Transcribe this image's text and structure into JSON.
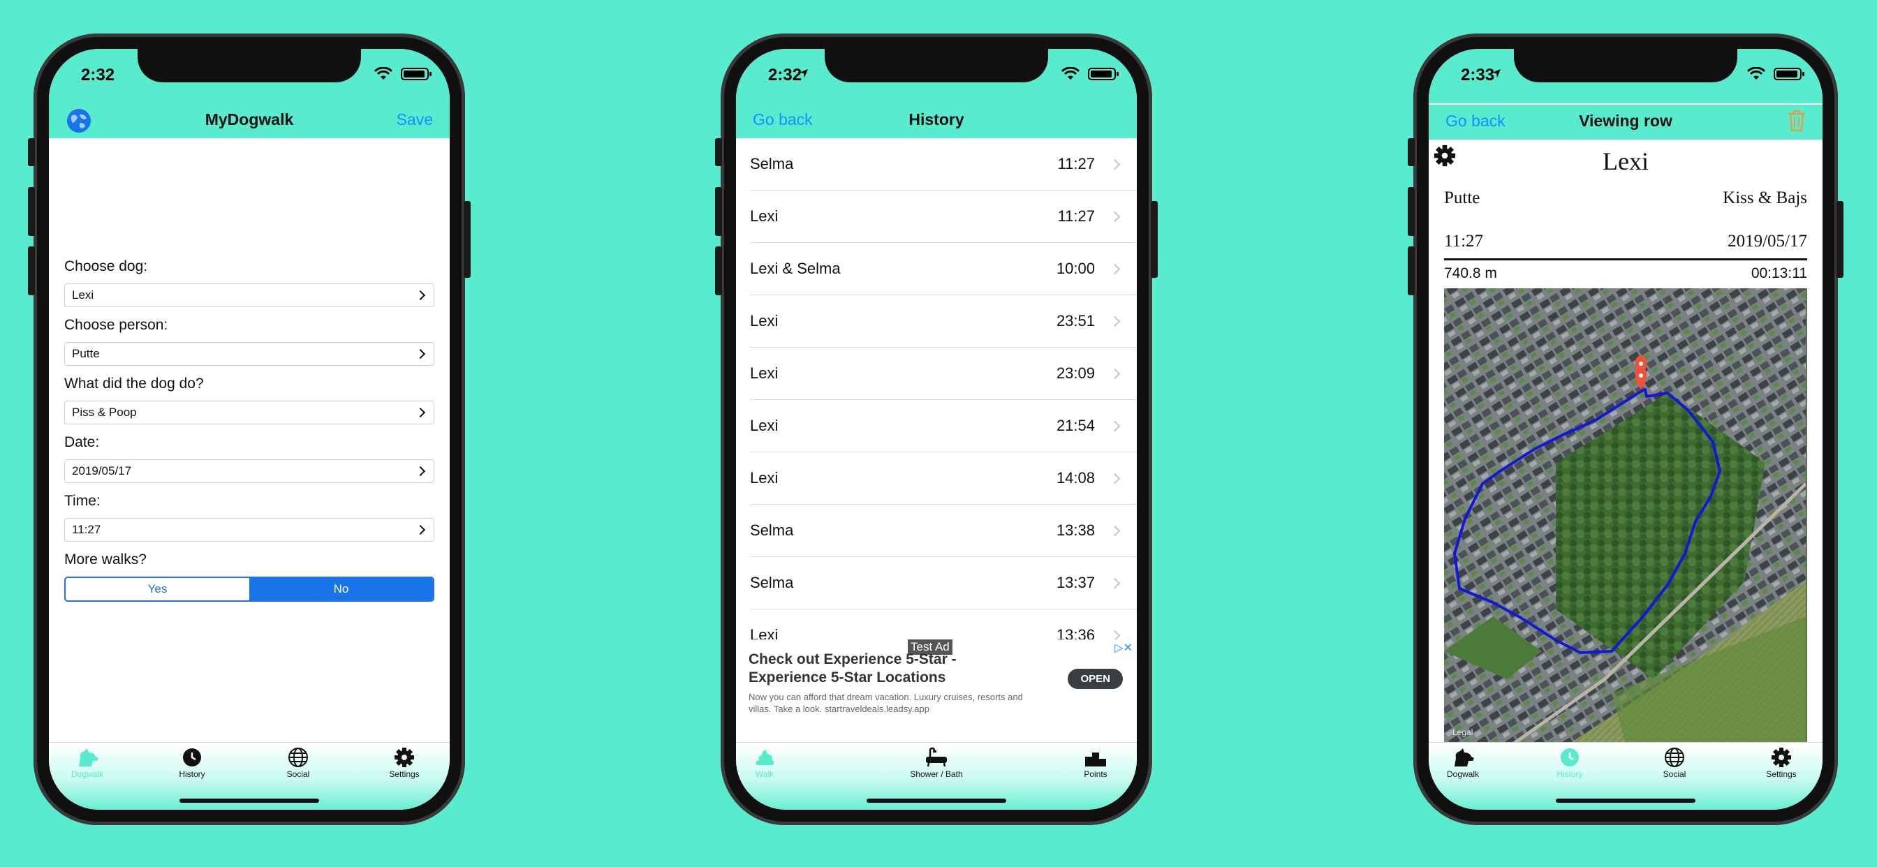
{
  "phone1": {
    "status_time": "2:32",
    "nav": {
      "title": "MyDogwalk",
      "right": "Save"
    },
    "form": {
      "dog_label": "Choose dog:",
      "dog_value": "Lexi",
      "person_label": "Choose person:",
      "person_value": "Putte",
      "action_label": "What did the dog do?",
      "action_value": "Piss & Poop",
      "date_label": "Date:",
      "date_value": "2019/05/17",
      "time_label": "Time:",
      "time_value": "11:27",
      "more_label": "More walks?",
      "yes": "Yes",
      "no": "No",
      "selected": "No"
    },
    "tabs": [
      "Dogwalk",
      "History",
      "Social",
      "Settings"
    ],
    "active_tab": "Dogwalk"
  },
  "phone2": {
    "status_time": "2:32",
    "nav": {
      "left": "Go back",
      "title": "History"
    },
    "rows": [
      {
        "name": "Selma",
        "time": "11:27"
      },
      {
        "name": "Lexi",
        "time": "11:27"
      },
      {
        "name": "Lexi & Selma",
        "time": "10:00"
      },
      {
        "name": "Lexi",
        "time": "23:51"
      },
      {
        "name": "Lexi",
        "time": "23:09"
      },
      {
        "name": "Lexi",
        "time": "21:54"
      },
      {
        "name": "Lexi",
        "time": "14:08"
      },
      {
        "name": "Selma",
        "time": "13:38"
      },
      {
        "name": "Selma",
        "time": "13:37"
      },
      {
        "name": "Lexi",
        "time": "13:36"
      }
    ],
    "ad": {
      "tag": "Test Ad",
      "headline": "Check out Experience 5-Star - Experience 5-Star Locations",
      "body": "Now you can afford that dream vacation. Luxury cruises, resorts and villas. Take a look. startraveldeals.leadsy.app",
      "button": "OPEN"
    },
    "tabs": [
      "Walk",
      "Shower / Bath",
      "Points"
    ],
    "active_tab": "Walk"
  },
  "phone3": {
    "status_time": "2:33",
    "nav": {
      "left": "Go back",
      "title": "Viewing row"
    },
    "dog": "Lexi",
    "person": "Putte",
    "action": "Kiss & Bajs",
    "time": "11:27",
    "date": "2019/05/17",
    "distance": "740.8 m",
    "duration": "00:13:11",
    "map_credit": "Legal",
    "tabs": [
      "Dogwalk",
      "History",
      "Social",
      "Settings"
    ],
    "active_tab": "History"
  },
  "colors": {
    "background": "#58ebce",
    "link": "#1a8cff",
    "segment": "#1a73e8",
    "route": "#1218d6",
    "pin": "#f0503c"
  }
}
